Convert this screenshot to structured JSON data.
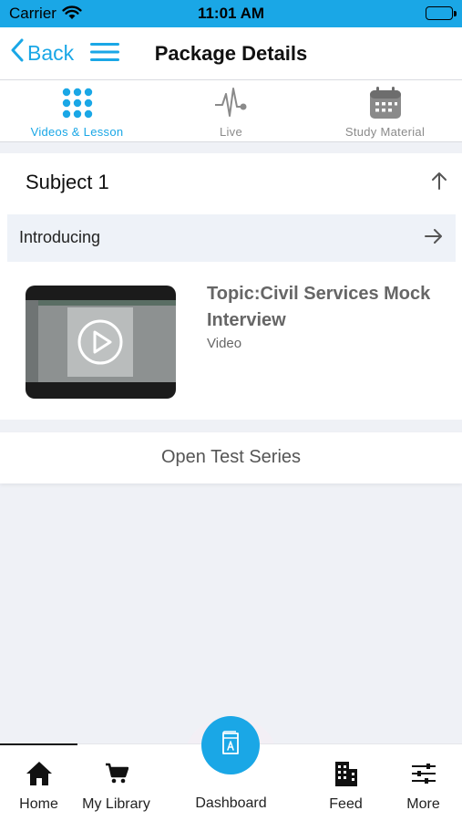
{
  "status_bar": {
    "carrier": "Carrier",
    "time": "11:01 AM"
  },
  "header": {
    "back_label": "Back",
    "title": "Package Details"
  },
  "tabs": [
    {
      "label": "Videos & Lesson",
      "icon": "grid-dots-icon",
      "active": true
    },
    {
      "label": "Live",
      "icon": "pulse-icon",
      "active": false
    },
    {
      "label": "Study Material",
      "icon": "calendar-icon",
      "active": false
    }
  ],
  "subject": {
    "title": "Subject 1"
  },
  "lesson": {
    "title": "Introducing"
  },
  "video": {
    "title": "Topic:Civil Services Mock Interview",
    "type": "Video"
  },
  "test_series": {
    "label": "Open Test Series"
  },
  "bottom_nav": {
    "home": "Home",
    "library": "My Library",
    "dashboard": "Dashboard",
    "feed": "Feed",
    "more": "More"
  },
  "colors": {
    "accent": "#1aa7e6",
    "background": "#eff1f6"
  }
}
